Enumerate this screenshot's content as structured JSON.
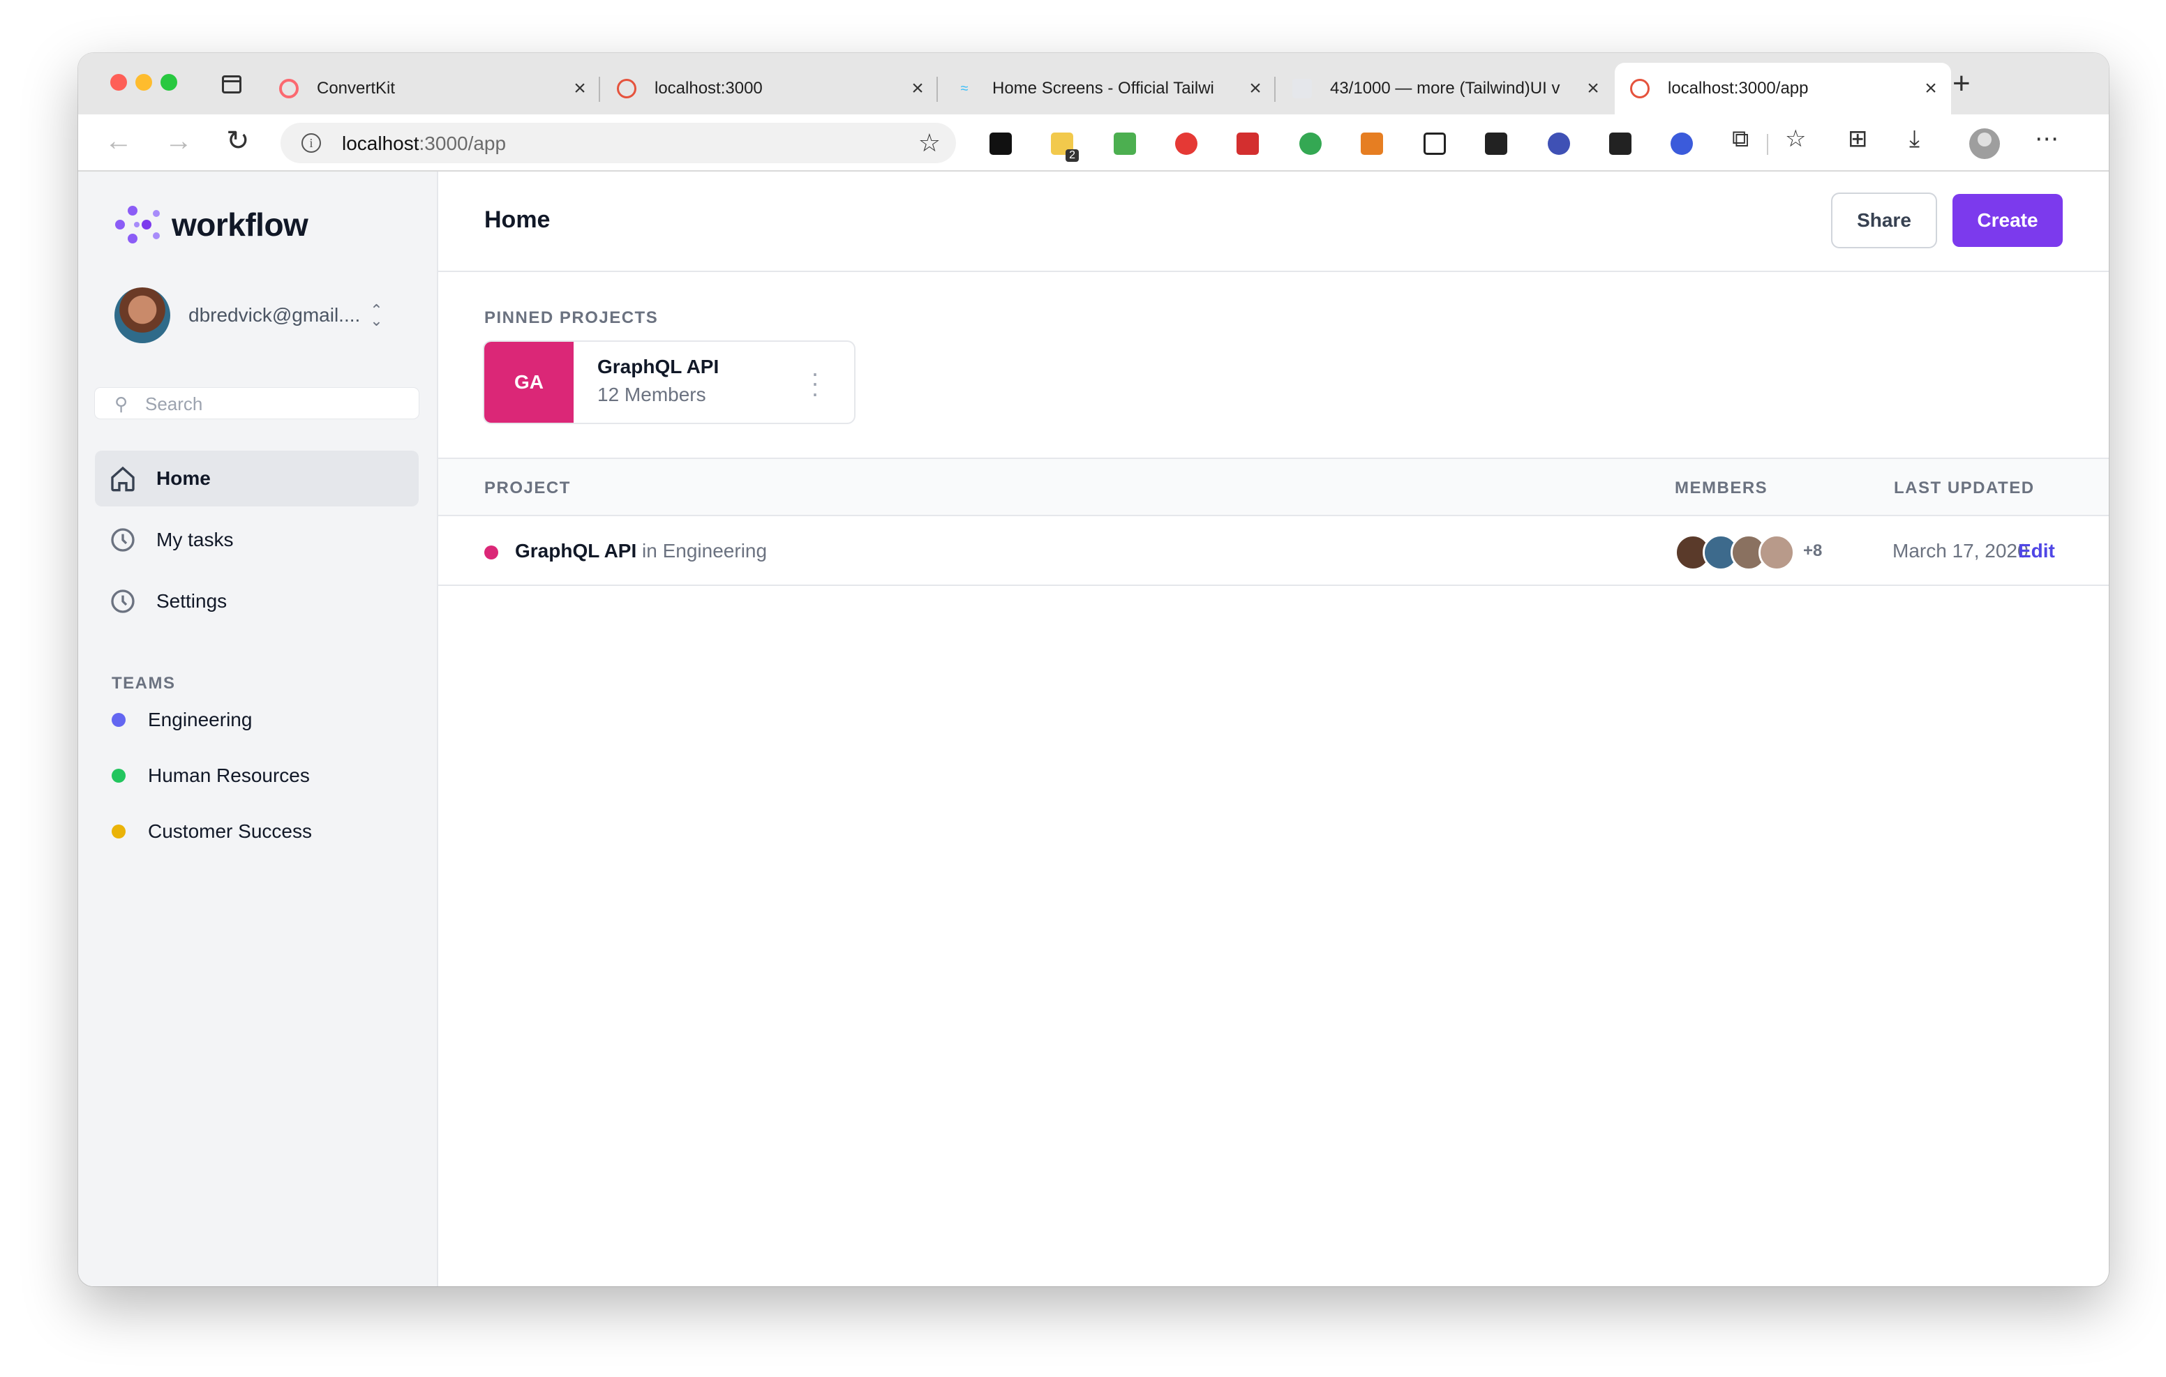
{
  "browser": {
    "tabs": [
      {
        "title": "ConvertKit",
        "close": "×",
        "favicon_color": "#fb6970"
      },
      {
        "title": "localhost:3000",
        "close": "×",
        "favicon_color": "#e5533d"
      },
      {
        "title": "Home Screens - Official Tailwi",
        "close": "×",
        "favicon_color": "#38bdf8"
      },
      {
        "title": "43/1000 — more (Tailwind)UI v",
        "close": "×",
        "favicon_color": "#9ca3af"
      },
      {
        "title": "localhost:3000/app",
        "close": "×",
        "favicon_color": "#e5533d"
      }
    ],
    "new_tab": "+",
    "url_host": "localhost",
    "url_rest": ":3000/app",
    "back": "←",
    "forward": "→",
    "reload": "↻",
    "info": "i",
    "favorite": "☆",
    "menu": "⋯",
    "extensions_glyph": "⧉",
    "favorites_glyph": "☆",
    "collections_glyph": "⊞",
    "downloads_glyph": "⤓",
    "extension_colors": [
      "#111111",
      "#f2c94c",
      "#4caf50",
      "#e53935",
      "#d32f2f",
      "#34a853",
      "#e67e22",
      "#222222",
      "#222222",
      "#3f51b5",
      "#222222",
      "#3b5bdb"
    ],
    "extension_badge": "2"
  },
  "app": {
    "brand": "workflow",
    "brand_color": "#7c3aed",
    "user": {
      "email": "dbredvick@gmail...."
    },
    "search": {
      "placeholder": "Search"
    },
    "nav": [
      {
        "label": "Home",
        "icon": "home-icon",
        "active": true
      },
      {
        "label": "My tasks",
        "icon": "clock-icon",
        "active": false
      },
      {
        "label": "Settings",
        "icon": "clock-icon",
        "active": false
      }
    ],
    "teams_heading": "TEAMS",
    "teams": [
      {
        "name": "Engineering",
        "color": "#6366f1"
      },
      {
        "name": "Human Resources",
        "color": "#22c55e"
      },
      {
        "name": "Customer Success",
        "color": "#eab308"
      }
    ]
  },
  "main": {
    "title": "Home",
    "share_label": "Share",
    "create_label": "Create",
    "pinned_heading": "PINNED PROJECTS",
    "pinned": [
      {
        "initials": "GA",
        "name": "GraphQL API",
        "members": "12 Members",
        "color": "#db2777"
      }
    ],
    "table": {
      "headers": {
        "project": "PROJECT",
        "members": "MEMBERS",
        "updated": "LAST UPDATED"
      },
      "rows": [
        {
          "name": "GraphQL API",
          "in": "in",
          "team": "Engineering",
          "more_members": "+8",
          "updated": "March 17, 2020",
          "action": "Edit",
          "avatar_colors": [
            "#5a3a2a",
            "#3d6a8c",
            "#8a7160",
            "#b89a8a"
          ]
        }
      ]
    }
  }
}
